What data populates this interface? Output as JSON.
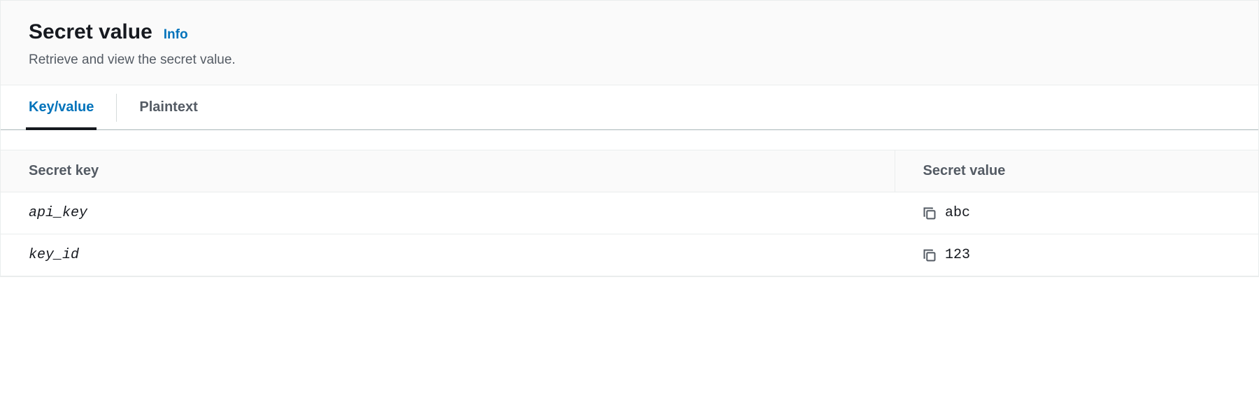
{
  "header": {
    "title": "Secret value",
    "info_label": "Info",
    "description": "Retrieve and view the secret value."
  },
  "tabs": {
    "keyvalue": "Key/value",
    "plaintext": "Plaintext"
  },
  "table": {
    "columns": {
      "key": "Secret key",
      "value": "Secret value"
    },
    "rows": [
      {
        "key": "api_key",
        "value": "abc"
      },
      {
        "key": "key_id",
        "value": "123"
      }
    ]
  }
}
